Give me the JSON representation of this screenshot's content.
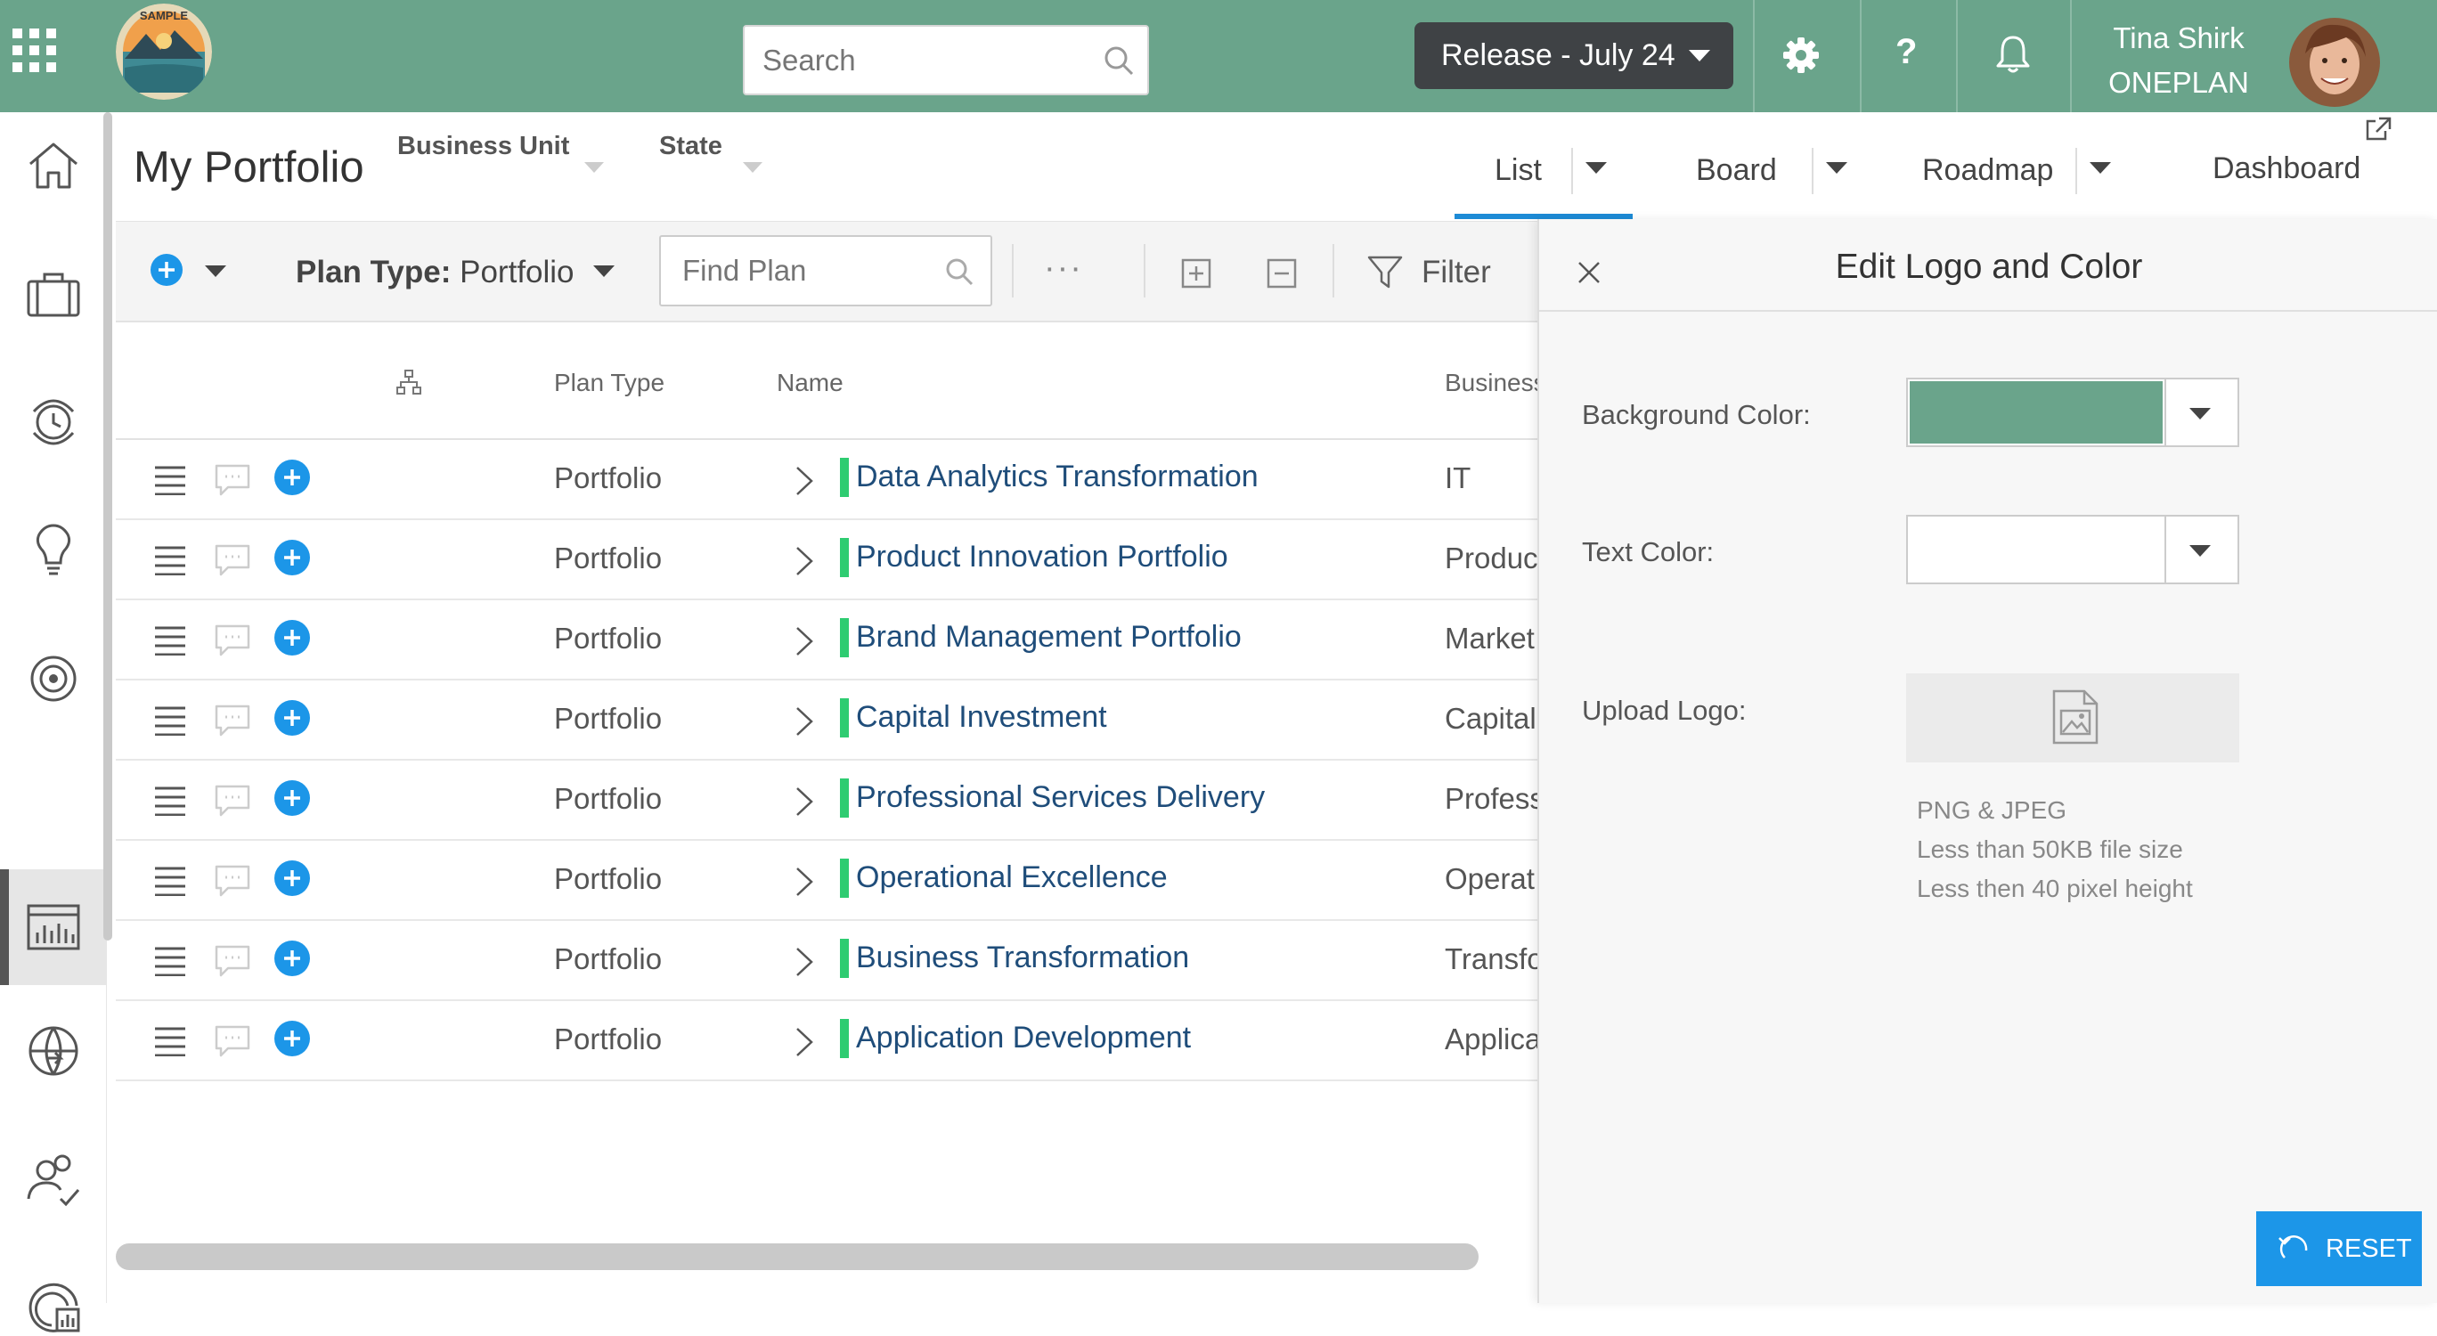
{
  "header": {
    "search_placeholder": "Search",
    "release_label": "Release - July 24",
    "help_label": "?",
    "user_name": "Tina Shirk",
    "user_org": "ONEPLAN",
    "logo_text": "SAMPLE",
    "bg_color": "#6aa48b"
  },
  "nav": {
    "items": [
      "home-icon",
      "briefcase-icon",
      "timesheet-icon",
      "idea-icon",
      "target-icon",
      "portfolio-chart-icon",
      "globe-icon",
      "resources-icon",
      "reports-icon"
    ],
    "active": "portfolio-chart-icon"
  },
  "portfolio": {
    "title": "My Portfolio",
    "filter_business_unit": "Business Unit",
    "filter_state": "State",
    "views": {
      "list": "List",
      "board": "Board",
      "roadmap": "Roadmap",
      "dashboard": "Dashboard"
    },
    "active_view": "List"
  },
  "toolbar": {
    "plan_type_label": "Plan Type:",
    "plan_type_value": "Portfolio",
    "find_placeholder": "Find Plan",
    "more_label": "···",
    "filter_label": "Filter"
  },
  "table": {
    "columns": {
      "plan_type": "Plan Type",
      "name": "Name",
      "business_unit": "Business"
    },
    "rows": [
      {
        "plan_type": "Portfolio",
        "name": "Data Analytics Transformation",
        "business_unit": "IT"
      },
      {
        "plan_type": "Portfolio",
        "name": "Product Innovation Portfolio",
        "business_unit": "Produc"
      },
      {
        "plan_type": "Portfolio",
        "name": "Brand Management Portfolio",
        "business_unit": "Market"
      },
      {
        "plan_type": "Portfolio",
        "name": "Capital Investment",
        "business_unit": "Capital"
      },
      {
        "plan_type": "Portfolio",
        "name": "Professional Services Delivery",
        "business_unit": "Profess"
      },
      {
        "plan_type": "Portfolio",
        "name": "Operational Excellence",
        "business_unit": "Operat"
      },
      {
        "plan_type": "Portfolio",
        "name": "Business Transformation",
        "business_unit": "Transfo"
      },
      {
        "plan_type": "Portfolio",
        "name": "Application Development",
        "business_unit": "Applica"
      }
    ],
    "accent_color": "#2ecc71"
  },
  "panel": {
    "title": "Edit Logo and Color",
    "background_color_label": "Background Color:",
    "background_color_value": "#6aa48b",
    "text_color_label": "Text Color:",
    "text_color_value": "#ffffff",
    "upload_logo_label": "Upload Logo:",
    "hint_format": "PNG & JPEG",
    "hint_size": "Less than 50KB file size",
    "hint_height": "Less then 40 pixel height",
    "reset_label": "RESET"
  }
}
